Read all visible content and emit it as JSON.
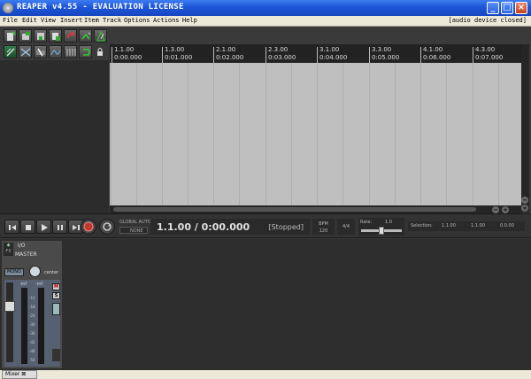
{
  "window": {
    "title": "REAPER v4.55 - EVALUATION LICENSE"
  },
  "menu": {
    "items": [
      "File",
      "Edit",
      "View",
      "Insert",
      "Item",
      "Track",
      "Options",
      "Actions",
      "Help"
    ],
    "status": "[audio device closed]"
  },
  "toolbar": {
    "icons": [
      "new-project-icon",
      "open-project-icon",
      "save-project-icon",
      "project-settings-icon",
      "undo-icon",
      "redo-icon",
      "metronome-icon",
      "grid-icon",
      "auto-crossfade-icon",
      "ripple-edit-icon",
      "envelope-icon",
      "snap-icon",
      "loop-icon",
      "lock-icon"
    ]
  },
  "ruler": {
    "marks": [
      {
        "bar": "1.1.00",
        "time": "0:00.000"
      },
      {
        "bar": "1.3.00",
        "time": "0:01.000"
      },
      {
        "bar": "2.1.00",
        "time": "0:02.000"
      },
      {
        "bar": "2.3.00",
        "time": "0:03.000"
      },
      {
        "bar": "3.1.00",
        "time": "0:04.000"
      },
      {
        "bar": "3.3.00",
        "time": "0:05.000"
      },
      {
        "bar": "4.1.00",
        "time": "0:06.000"
      },
      {
        "bar": "4.3.00",
        "time": "0:07.000"
      }
    ]
  },
  "transport": {
    "global_auto": "GLOBAL AUTO",
    "none": "NONE",
    "time": "1.1.00 / 0:00.000",
    "state": "[Stopped]",
    "bpm_label": "BPM",
    "bpm_value": "120",
    "time_sig": "4/4",
    "rate_label": "Rate:",
    "rate_value": "1.0",
    "rate_level": 0.5,
    "selection_label": "Selection:",
    "sel_start": "1.1.00",
    "sel_end": "1.1.00",
    "sel_length": "0.0.00"
  },
  "mixer": {
    "fx": "FX",
    "io": "I/O",
    "name": "MASTER",
    "mono": "MONO",
    "pan": "center",
    "left_level": "-inf",
    "right_level": "-inf",
    "scale": [
      "-12",
      "-18",
      "-24",
      "-30",
      "-36",
      "-42",
      "-48",
      "-54"
    ],
    "m": "M",
    "s": "S",
    "tab_label": "Mixer"
  }
}
